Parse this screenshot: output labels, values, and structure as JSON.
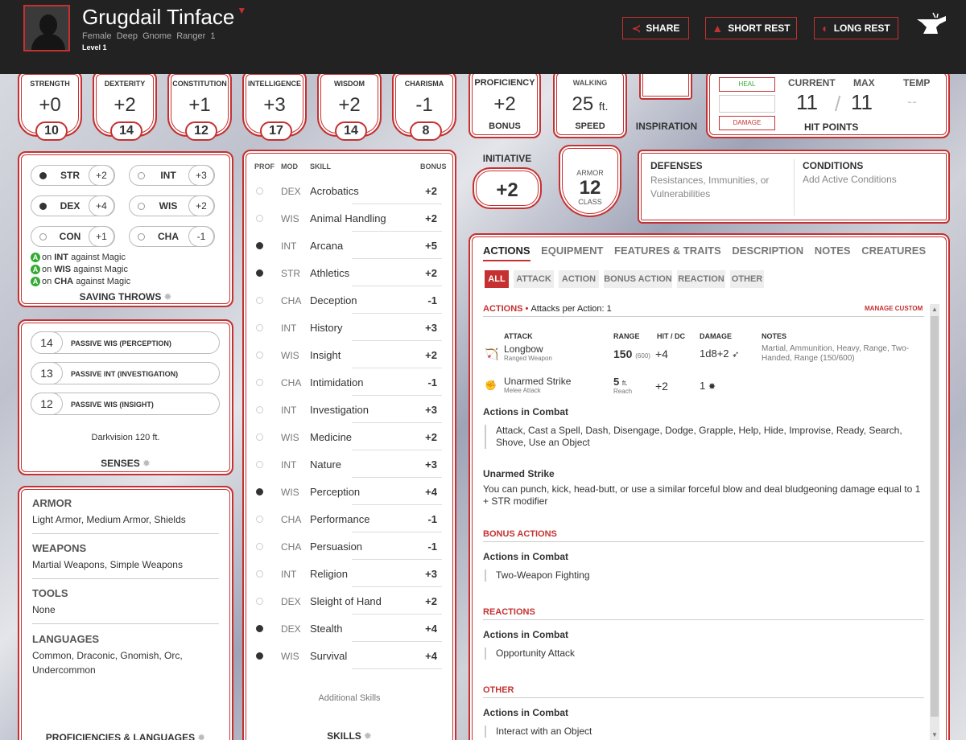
{
  "header": {
    "name": "Grugdail Tinface",
    "subtitle": "Female  Deep Gnome  Ranger 1",
    "level": "Level 1",
    "buttons": {
      "share": "SHARE",
      "short_rest": "SHORT REST",
      "long_rest": "LONG REST"
    }
  },
  "abilities": [
    {
      "label": "STRENGTH",
      "mod": "+0",
      "score": "10"
    },
    {
      "label": "DEXTERITY",
      "mod": "+2",
      "score": "14"
    },
    {
      "label": "CONSTITUTION",
      "mod": "+1",
      "score": "12"
    },
    {
      "label": "INTELLIGENCE",
      "mod": "+3",
      "score": "17"
    },
    {
      "label": "WISDOM",
      "mod": "+2",
      "score": "14"
    },
    {
      "label": "CHARISMA",
      "mod": "-1",
      "score": "8"
    }
  ],
  "proficiency": {
    "top": "PROFICIENCY",
    "value": "+2",
    "bottom": "BONUS"
  },
  "speed": {
    "top": "WALKING",
    "value": "25",
    "unit": "ft.",
    "bottom": "SPEED"
  },
  "inspiration": {
    "label": "INSPIRATION"
  },
  "hp": {
    "heal": "HEAL",
    "damage": "DAMAGE",
    "current_label": "CURRENT",
    "max_label": "MAX",
    "temp_label": "TEMP",
    "current": "11",
    "max": "11",
    "temp": "--",
    "title": "HIT POINTS"
  },
  "initiative": {
    "label": "INITIATIVE",
    "value": "+2"
  },
  "armor": {
    "top": "ARMOR",
    "value": "12",
    "bottom": "CLASS"
  },
  "defenses": {
    "title": "DEFENSES",
    "text": "Resistances, Immunities, or Vulnerabilities"
  },
  "conditions": {
    "title": "CONDITIONS",
    "text": "Add Active Conditions"
  },
  "saving_throws": {
    "items": [
      {
        "ab": "STR",
        "bonus": "+2",
        "prof": true
      },
      {
        "ab": "INT",
        "bonus": "+3",
        "prof": false
      },
      {
        "ab": "DEX",
        "bonus": "+4",
        "prof": true
      },
      {
        "ab": "WIS",
        "bonus": "+2",
        "prof": false
      },
      {
        "ab": "CON",
        "bonus": "+1",
        "prof": false
      },
      {
        "ab": "CHA",
        "bonus": "-1",
        "prof": false
      }
    ],
    "advantages": [
      {
        "pre": "on ",
        "ab": "INT",
        "post": " against Magic"
      },
      {
        "pre": "on ",
        "ab": "WIS",
        "post": " against Magic"
      },
      {
        "pre": "on ",
        "ab": "CHA",
        "post": " against Magic"
      }
    ],
    "adv_letter": "A",
    "title": "SAVING THROWS"
  },
  "senses": {
    "items": [
      {
        "value": "14",
        "label": "PASSIVE WIS (PERCEPTION)"
      },
      {
        "value": "13",
        "label": "PASSIVE INT (INVESTIGATION)"
      },
      {
        "value": "12",
        "label": "PASSIVE WIS (INSIGHT)"
      }
    ],
    "darkvision": "Darkvision 120 ft.",
    "title": "SENSES"
  },
  "proficiencies": {
    "sections": [
      {
        "h": "ARMOR",
        "v": "Light Armor, Medium Armor, Shields"
      },
      {
        "h": "WEAPONS",
        "v": "Martial Weapons, Simple Weapons"
      },
      {
        "h": "TOOLS",
        "v": "None"
      },
      {
        "h": "LANGUAGES",
        "v": "Common, Draconic, Gnomish, Orc, Undercommon"
      }
    ],
    "title": "PROFICIENCIES & LANGUAGES"
  },
  "skills": {
    "headers": {
      "prof": "PROF",
      "mod": "MOD",
      "skill": "SKILL",
      "bonus": "BONUS"
    },
    "items": [
      {
        "mod": "DEX",
        "name": "Acrobatics",
        "bonus": "+2",
        "prof": false
      },
      {
        "mod": "WIS",
        "name": "Animal Handling",
        "bonus": "+2",
        "prof": false
      },
      {
        "mod": "INT",
        "name": "Arcana",
        "bonus": "+5",
        "prof": true
      },
      {
        "mod": "STR",
        "name": "Athletics",
        "bonus": "+2",
        "prof": true
      },
      {
        "mod": "CHA",
        "name": "Deception",
        "bonus": "-1",
        "prof": false
      },
      {
        "mod": "INT",
        "name": "History",
        "bonus": "+3",
        "prof": false
      },
      {
        "mod": "WIS",
        "name": "Insight",
        "bonus": "+2",
        "prof": false
      },
      {
        "mod": "CHA",
        "name": "Intimidation",
        "bonus": "-1",
        "prof": false
      },
      {
        "mod": "INT",
        "name": "Investigation",
        "bonus": "+3",
        "prof": false
      },
      {
        "mod": "WIS",
        "name": "Medicine",
        "bonus": "+2",
        "prof": false
      },
      {
        "mod": "INT",
        "name": "Nature",
        "bonus": "+3",
        "prof": false
      },
      {
        "mod": "WIS",
        "name": "Perception",
        "bonus": "+4",
        "prof": true
      },
      {
        "mod": "CHA",
        "name": "Performance",
        "bonus": "-1",
        "prof": false
      },
      {
        "mod": "CHA",
        "name": "Persuasion",
        "bonus": "-1",
        "prof": false
      },
      {
        "mod": "INT",
        "name": "Religion",
        "bonus": "+3",
        "prof": false
      },
      {
        "mod": "DEX",
        "name": "Sleight of Hand",
        "bonus": "+2",
        "prof": false
      },
      {
        "mod": "DEX",
        "name": "Stealth",
        "bonus": "+4",
        "prof": true
      },
      {
        "mod": "WIS",
        "name": "Survival",
        "bonus": "+4",
        "prof": true
      }
    ],
    "additional": "Additional Skills",
    "title": "SKILLS"
  },
  "actions": {
    "tabs": [
      "ACTIONS",
      "EQUIPMENT",
      "FEATURES & TRAITS",
      "DESCRIPTION",
      "NOTES",
      "CREATURES"
    ],
    "filters": [
      "ALL",
      "ATTACK",
      "ACTION",
      "BONUS ACTION",
      "REACTION",
      "OTHER"
    ],
    "section_title": "ACTIONS",
    "per_action": "Attacks per Action: 1",
    "manage": "MANAGE CUSTOM",
    "cols": {
      "attack": "ATTACK",
      "range": "RANGE",
      "hit": "HIT / DC",
      "damage": "DAMAGE",
      "notes": "NOTES"
    },
    "attacks": [
      {
        "name": "Longbow",
        "type": "Ranged Weapon",
        "range": "150",
        "range_long": "(600)",
        "hit": "+4",
        "damage": "1d8+2",
        "notes": "Martial, Ammunition, Heavy, Range, Two-Handed, Range (150/600)"
      },
      {
        "name": "Unarmed Strike",
        "type": "Melee Attack",
        "range": "5",
        "range_unit": "ft.",
        "range_sub": "Reach",
        "hit": "+2",
        "damage": "1",
        "notes": ""
      }
    ],
    "combat_h": "Actions in Combat",
    "combat_text": "Attack, Cast a Spell, Dash, Disengage, Dodge, Grapple, Help, Hide, Improvise, Ready, Search, Shove, Use an Object",
    "unarmed_h": "Unarmed Strike",
    "unarmed_text": "You can punch, kick, head-butt, or use a similar forceful blow and deal bludgeoning damage equal to 1 + STR modifier",
    "bonus_title": "BONUS ACTIONS",
    "bonus_h": "Actions in Combat",
    "bonus_text": "Two-Weapon Fighting",
    "reactions_title": "REACTIONS",
    "reactions_h": "Actions in Combat",
    "reactions_text": "Opportunity Attack",
    "other_title": "OTHER",
    "other_h": "Actions in Combat",
    "other_text": "Interact with an Object"
  },
  "colors": {
    "accent": "#c53131",
    "header_bg": "#222222",
    "advantage": "#33aa33"
  }
}
